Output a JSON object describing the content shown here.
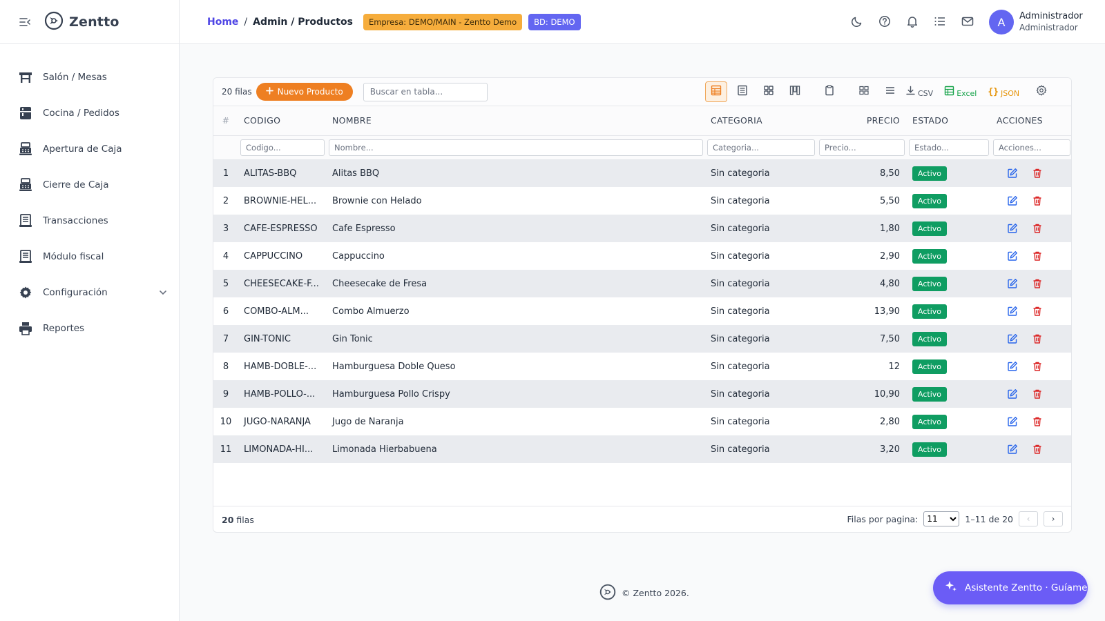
{
  "app": {
    "brand": "Zentto"
  },
  "sidebar": {
    "items": [
      {
        "label": "Salón / Mesas",
        "icon": "table-icon"
      },
      {
        "label": "Cocina / Pedidos",
        "icon": "kitchen-icon"
      },
      {
        "label": "Apertura de Caja",
        "icon": "cash-register-icon"
      },
      {
        "label": "Cierre de Caja",
        "icon": "cash-register-icon"
      },
      {
        "label": "Transacciones",
        "icon": "receipt-icon"
      },
      {
        "label": "Módulo fiscal",
        "icon": "receipt-icon"
      },
      {
        "label": "Configuración",
        "icon": "gear-icon"
      },
      {
        "label": "Reportes",
        "icon": "printer-icon"
      }
    ]
  },
  "header": {
    "breadcrumb_home": "Home",
    "breadcrumb_sep": "/",
    "breadcrumb_current": "Admin / Productos",
    "empresa_badge": "Empresa: DEMO/MAIN - Zentto Demo",
    "bd_badge": "BD: DEMO",
    "icons": [
      "moon-icon",
      "help-icon",
      "bell-icon",
      "list-icon",
      "mail-icon"
    ],
    "user": {
      "initial": "A",
      "name": "Administrador",
      "role": "Administrador"
    }
  },
  "toolbar": {
    "row_count": "20 filas",
    "new_button": "Nuevo Producto",
    "search_placeholder": "Buscar en tabla...",
    "csv": "CSV",
    "excel": "Excel",
    "json": "JSON"
  },
  "table": {
    "columns": {
      "num": "#",
      "codigo": "CODIGO",
      "nombre": "NOMBRE",
      "categoria": "CATEGORIA",
      "precio": "PRECIO",
      "estado": "ESTADO",
      "acciones": "ACCIONES"
    },
    "filters": {
      "codigo": "Codigo...",
      "nombre": "Nombre...",
      "categoria": "Categoria...",
      "precio": "Precio...",
      "estado": "Estado...",
      "acciones": "Acciones..."
    },
    "rows": [
      {
        "num": "1",
        "codigo": "ALITAS-BBQ",
        "nombre": "Alitas BBQ",
        "categoria": "Sin categoria",
        "precio": "8,50",
        "estado": "Activo"
      },
      {
        "num": "2",
        "codigo": "BROWNIE-HEL...",
        "nombre": "Brownie con Helado",
        "categoria": "Sin categoria",
        "precio": "5,50",
        "estado": "Activo"
      },
      {
        "num": "3",
        "codigo": "CAFE-ESPRESSO",
        "nombre": "Cafe Espresso",
        "categoria": "Sin categoria",
        "precio": "1,80",
        "estado": "Activo"
      },
      {
        "num": "4",
        "codigo": "CAPPUCCINO",
        "nombre": "Cappuccino",
        "categoria": "Sin categoria",
        "precio": "2,90",
        "estado": "Activo"
      },
      {
        "num": "5",
        "codigo": "CHEESECAKE-F...",
        "nombre": "Cheesecake de Fresa",
        "categoria": "Sin categoria",
        "precio": "4,80",
        "estado": "Activo"
      },
      {
        "num": "6",
        "codigo": "COMBO-ALM...",
        "nombre": "Combo Almuerzo",
        "categoria": "Sin categoria",
        "precio": "13,90",
        "estado": "Activo"
      },
      {
        "num": "7",
        "codigo": "GIN-TONIC",
        "nombre": "Gin Tonic",
        "categoria": "Sin categoria",
        "precio": "7,50",
        "estado": "Activo"
      },
      {
        "num": "8",
        "codigo": "HAMB-DOBLE-...",
        "nombre": "Hamburguesa Doble Queso",
        "categoria": "Sin categoria",
        "precio": "12",
        "estado": "Activo"
      },
      {
        "num": "9",
        "codigo": "HAMB-POLLO-...",
        "nombre": "Hamburguesa Pollo Crispy",
        "categoria": "Sin categoria",
        "precio": "10,90",
        "estado": "Activo"
      },
      {
        "num": "10",
        "codigo": "JUGO-NARANJA",
        "nombre": "Jugo de Naranja",
        "categoria": "Sin categoria",
        "precio": "2,80",
        "estado": "Activo"
      },
      {
        "num": "11",
        "codigo": "LIMONADA-HI...",
        "nombre": "Limonada Hierbabuena",
        "categoria": "Sin categoria",
        "precio": "3,20",
        "estado": "Activo"
      }
    ]
  },
  "footer": {
    "total_number": "20",
    "total_suffix": "filas",
    "rows_per_page_label": "Filas por pagina:",
    "rows_per_page_value": "11",
    "range": "1–11 de 20",
    "prev": "‹",
    "next": "›"
  },
  "page_footer": {
    "copyright": "© Zentto 2026."
  },
  "assistant": {
    "label": "Asistente Zentto · Guíame"
  },
  "colors": {
    "accent": "#6366f1",
    "orange": "#ee7f22",
    "status_green": "#0f9d62",
    "delete_red": "#dc2626",
    "edit_blue": "#2563eb"
  }
}
